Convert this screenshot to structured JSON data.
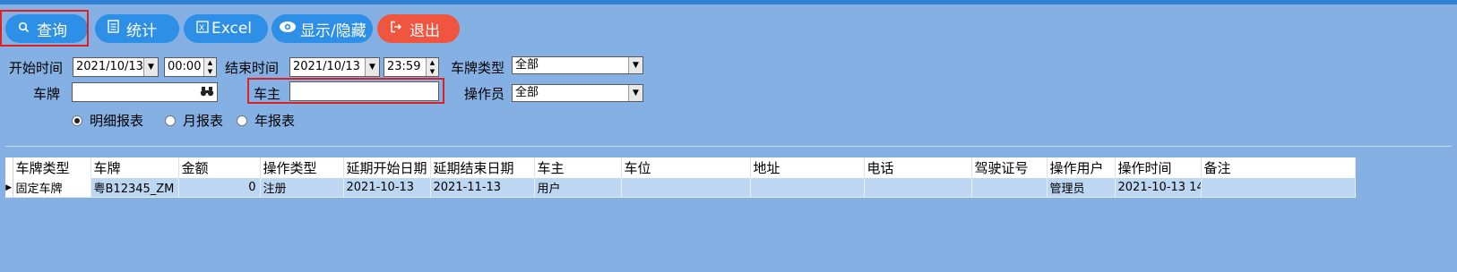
{
  "toolbar": {
    "query_label": "查询",
    "stats_label": "统计",
    "excel_label": "Excel",
    "toggle_label": "显示/隐藏",
    "exit_label": "退出"
  },
  "filters": {
    "start_time_label": "开始时间",
    "start_date": "2021/10/13",
    "start_clock": "00:00",
    "end_time_label": "结束时间",
    "end_date": "2021/10/13",
    "end_clock": "23:59",
    "plate_type_label": "车牌类型",
    "plate_type_value": "全部",
    "plate_label": "车牌",
    "plate_value": "",
    "owner_label": "车主",
    "owner_value": "",
    "operator_label": "操作员",
    "operator_value": "全部"
  },
  "report_type": {
    "options": [
      "明细报表",
      "月报表",
      "年报表"
    ],
    "selected": "明细报表"
  },
  "table": {
    "columns": [
      "车牌类型",
      "车牌",
      "金额",
      "操作类型",
      "延期开始日期",
      "延期结束日期",
      "车主",
      "车位",
      "地址",
      "电话",
      "驾驶证号",
      "操作用户",
      "操作时间",
      "备注"
    ],
    "rows": [
      [
        "固定车牌",
        "粤B12345_ZM",
        "0",
        "注册",
        "2021-10-13",
        "2021-11-13",
        "用户",
        "",
        "",
        "",
        "",
        "管理员",
        "2021-10-13 14",
        ""
      ]
    ]
  },
  "colors": {
    "background": "#84b0e4",
    "button": "#2d8fe6",
    "exit_button": "#f0563f",
    "highlight_box": "#e02020"
  }
}
